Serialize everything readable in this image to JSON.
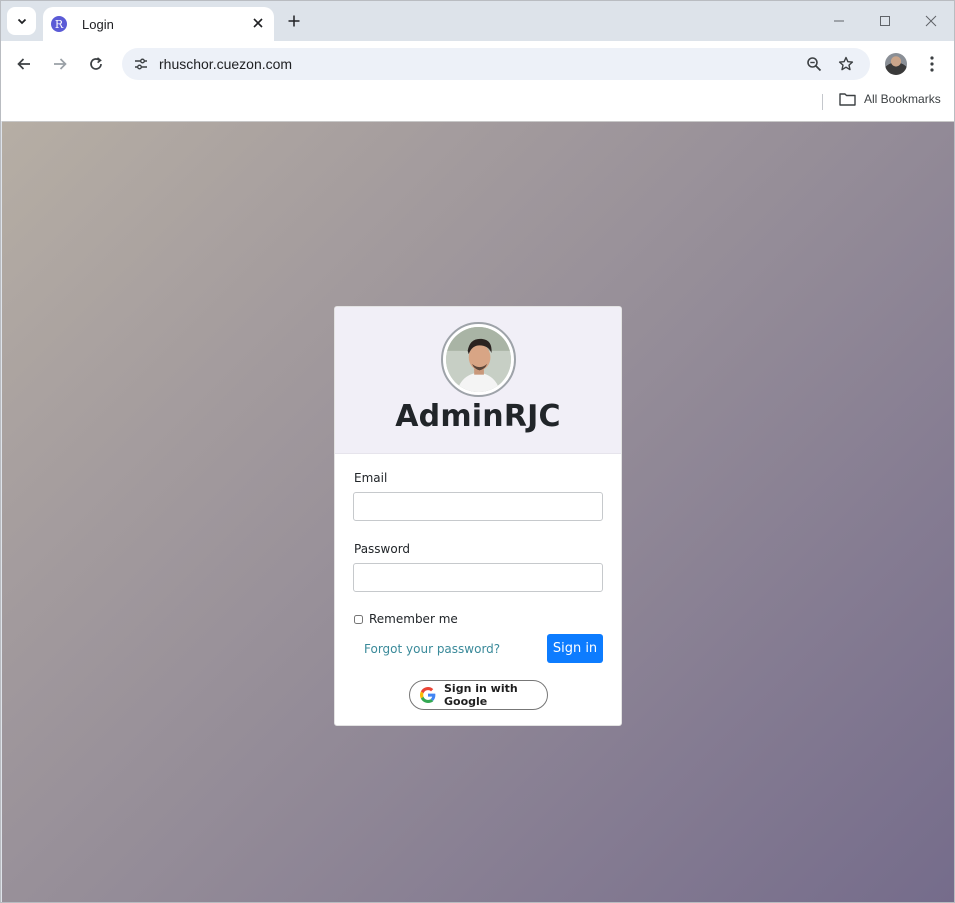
{
  "browser": {
    "tab_title": "Login",
    "favicon_letter": "R",
    "url": "rhuschor.cuezon.com",
    "bookmarks_label": "All Bookmarks"
  },
  "login": {
    "brand": "AdminRJC",
    "email_label": "Email",
    "email_value": "",
    "password_label": "Password",
    "password_value": "",
    "remember_label": "Remember me",
    "forgot_label": "Forgot your password?",
    "signin_label": "Sign in",
    "google_label": "Sign in with Google"
  },
  "colors": {
    "primary": "#0d7cff",
    "link": "#3a8a9a",
    "header_bg": "#f1eff7"
  }
}
